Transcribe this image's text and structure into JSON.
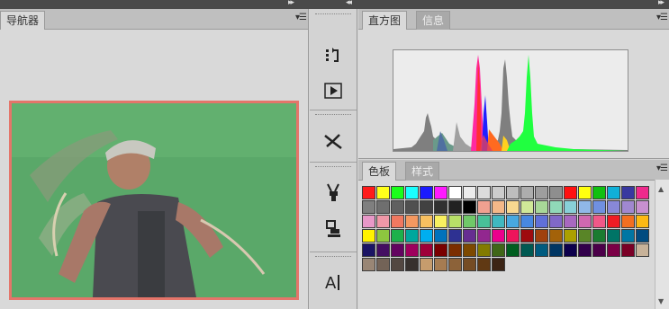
{
  "navigator": {
    "tab": "导航器"
  },
  "histogram": {
    "tabs": [
      "直方图",
      "信息"
    ]
  },
  "swatches_panel": {
    "tabs": [
      "色板",
      "样式"
    ],
    "colors": [
      "#ff1a1a",
      "#ffff1a",
      "#1aff1a",
      "#1affff",
      "#1a1aff",
      "#ff1aff",
      "#ffffff",
      "#ececec",
      "#dcdcdc",
      "#cccccc",
      "#bdbdbd",
      "#adadad",
      "#9e9e9e",
      "#8e8e8e",
      "#ff1010",
      "#ffff10",
      "#10c010",
      "#10b0d8",
      "#3838a0",
      "#ee2a8c",
      "#7f7f7f",
      "#6f6f6f",
      "#606060",
      "#505050",
      "#414141",
      "#313131",
      "#222222",
      "#000000",
      "#f0a090",
      "#f4b888",
      "#f8d890",
      "#d0e898",
      "#a8d898",
      "#90d8b8",
      "#88d0d8",
      "#90b8e8",
      "#7090e0",
      "#8888d8",
      "#a088d0",
      "#c890d0",
      "#e898c8",
      "#f098a8",
      "#f07860",
      "#f49860",
      "#f8c060",
      "#f8f060",
      "#b8e068",
      "#70c868",
      "#48c098",
      "#40b8c0",
      "#48a8e0",
      "#4888e0",
      "#6070d8",
      "#8068c8",
      "#a868c0",
      "#d068b0",
      "#f05888",
      "#ee1c24",
      "#f36f21",
      "#fdb913",
      "#fff200",
      "#8dc63f",
      "#1db14b",
      "#00a79d",
      "#00aeef",
      "#0072bc",
      "#2e3192",
      "#662d91",
      "#92278f",
      "#ec008c",
      "#ed145b",
      "#9e0b0f",
      "#a0410d",
      "#a36209",
      "#aba000",
      "#598527",
      "#1a7b30",
      "#007466",
      "#0076a3",
      "#004b80",
      "#1b1464",
      "#440e62",
      "#630460",
      "#9e005d",
      "#9e0039",
      "#790000",
      "#7b2e00",
      "#7d4900",
      "#827b00",
      "#406618",
      "#005e20",
      "#005952",
      "#005b7f",
      "#003663",
      "#0d004c",
      "#32004b",
      "#4b0049",
      "#7b0046",
      "#7a0026",
      "#c7b299",
      "#998675",
      "#736357",
      "#534741",
      "#37302d",
      "#c69c6d",
      "#a67c52",
      "#8c6239",
      "#754c24",
      "#603913",
      "#3c2415"
    ]
  },
  "tools": [
    {
      "name": "history-brush-tool-icon",
      "glyph": "⁰⤴"
    },
    {
      "name": "actions-play-icon",
      "glyph": "▶"
    },
    {
      "name": "brush-tool-presets-icon",
      "glyph": "✂"
    },
    {
      "name": "brush-panel-icon",
      "glyph": "✌"
    },
    {
      "name": "clone-source-icon",
      "glyph": "⎘"
    },
    {
      "name": "character-panel-icon",
      "glyph": "A|"
    }
  ]
}
